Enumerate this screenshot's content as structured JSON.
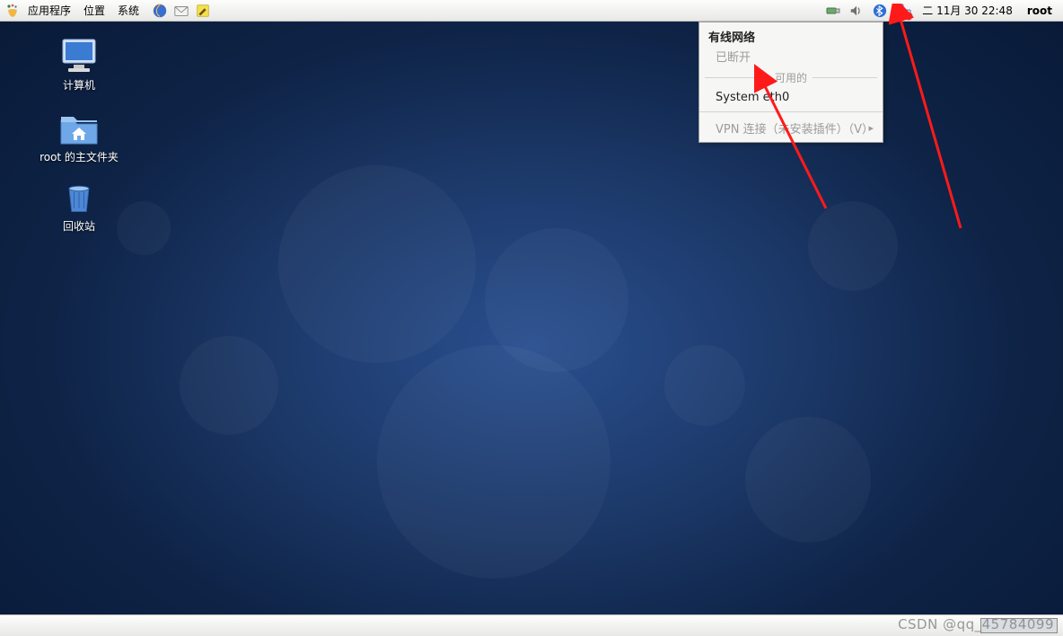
{
  "panel": {
    "menus": {
      "apps": "应用程序",
      "places": "位置",
      "system": "系统"
    },
    "tray": {
      "usb_icon": "usb-icon",
      "volume_icon": "volume-icon",
      "bluetooth_icon": "bluetooth-icon",
      "network_icon": "network-icon"
    },
    "clock": "二  11月  30 22:48",
    "user": "root"
  },
  "desktop": {
    "computer": "计算机",
    "home": "root 的主文件夹",
    "trash": "回收站"
  },
  "nm_menu": {
    "wired_header": "有线网络",
    "disconnected": "已断开",
    "available": "可用的",
    "eth0": "System eth0",
    "vpn": "VPN 连接（未安装插件）（V）"
  },
  "watermark": "CSDN @qq_45784099"
}
